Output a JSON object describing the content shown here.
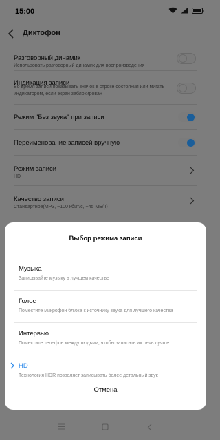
{
  "status": {
    "time": "15:00"
  },
  "header": {
    "title": "Диктофон"
  },
  "settings": [
    {
      "label": "Разговорный динамик",
      "sub": "Использовать разговорный динамик для воспроизведения",
      "control": "toggle",
      "on": false
    },
    {
      "label": "Индикация записи",
      "sub": "Во время записи показывать значок в строке состояния или мигать индикатором, если экран заблокирован",
      "control": "toggle",
      "on": false
    },
    {
      "label": "Режим \"Без звука\" при записи",
      "control": "toggle",
      "on": true
    },
    {
      "label": "Переименование записей вручную",
      "control": "toggle",
      "on": true
    },
    {
      "label": "Режим записи",
      "sub": "HD",
      "control": "chevron"
    },
    {
      "label": "Качество записи",
      "sub": "Стандартное(MP3, ~100 кбит/с, ~45 МБ/ч)",
      "control": "chevron"
    }
  ],
  "dialog": {
    "title": "Выбор режима записи",
    "options": [
      {
        "name": "Музыка",
        "desc": "Записывайте музыку в лучшем качестве",
        "selected": false
      },
      {
        "name": "Голос",
        "desc": "Поместите микрофон ближе к источнику звука для лучшего качества",
        "selected": false
      },
      {
        "name": "Интервью",
        "desc": "Поместите телефон между людьми, чтобы записать их речь лучше",
        "selected": false
      },
      {
        "name": "HD",
        "desc": "Технология HDR позволяет записывать более детальный звук",
        "selected": true
      }
    ],
    "cancel": "Отмена"
  },
  "colors": {
    "accent": "#2f8bea",
    "dim_background": "#7d7d7d",
    "sheet": "#ffffff"
  },
  "icons": {
    "status": [
      "wifi-icon",
      "signal-icon",
      "battery-icon"
    ],
    "nav": [
      "menu-icon",
      "home-icon",
      "back-nav-icon"
    ]
  }
}
